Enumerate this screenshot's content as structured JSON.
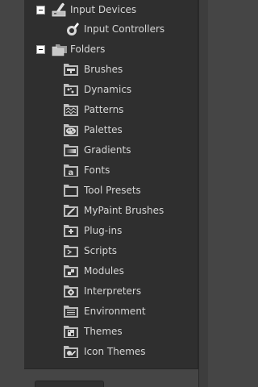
{
  "tree": {
    "input_devices": {
      "label": "Input Devices",
      "icon": "input-devices-icon",
      "expanded": true,
      "children": [
        {
          "label": "Input Controllers",
          "icon": "input-controllers-icon"
        }
      ]
    },
    "folders": {
      "label": "Folders",
      "icon": "folders-icon",
      "expanded": true,
      "children": [
        {
          "label": "Brushes",
          "icon": "brushes-folder-icon"
        },
        {
          "label": "Dynamics",
          "icon": "dynamics-folder-icon"
        },
        {
          "label": "Patterns",
          "icon": "patterns-folder-icon"
        },
        {
          "label": "Palettes",
          "icon": "palettes-folder-icon"
        },
        {
          "label": "Gradients",
          "icon": "gradients-folder-icon"
        },
        {
          "label": "Fonts",
          "icon": "fonts-folder-icon"
        },
        {
          "label": "Tool Presets",
          "icon": "tool-presets-folder-icon"
        },
        {
          "label": "MyPaint Brushes",
          "icon": "mypaint-brushes-folder-icon"
        },
        {
          "label": "Plug-ins",
          "icon": "plug-ins-folder-icon"
        },
        {
          "label": "Scripts",
          "icon": "scripts-folder-icon"
        },
        {
          "label": "Modules",
          "icon": "modules-folder-icon"
        },
        {
          "label": "Interpreters",
          "icon": "interpreters-folder-icon"
        },
        {
          "label": "Environment",
          "icon": "environment-folder-icon"
        },
        {
          "label": "Themes",
          "icon": "themes-folder-icon"
        },
        {
          "label": "Icon Themes",
          "icon": "icon-themes-folder-icon"
        }
      ]
    }
  }
}
